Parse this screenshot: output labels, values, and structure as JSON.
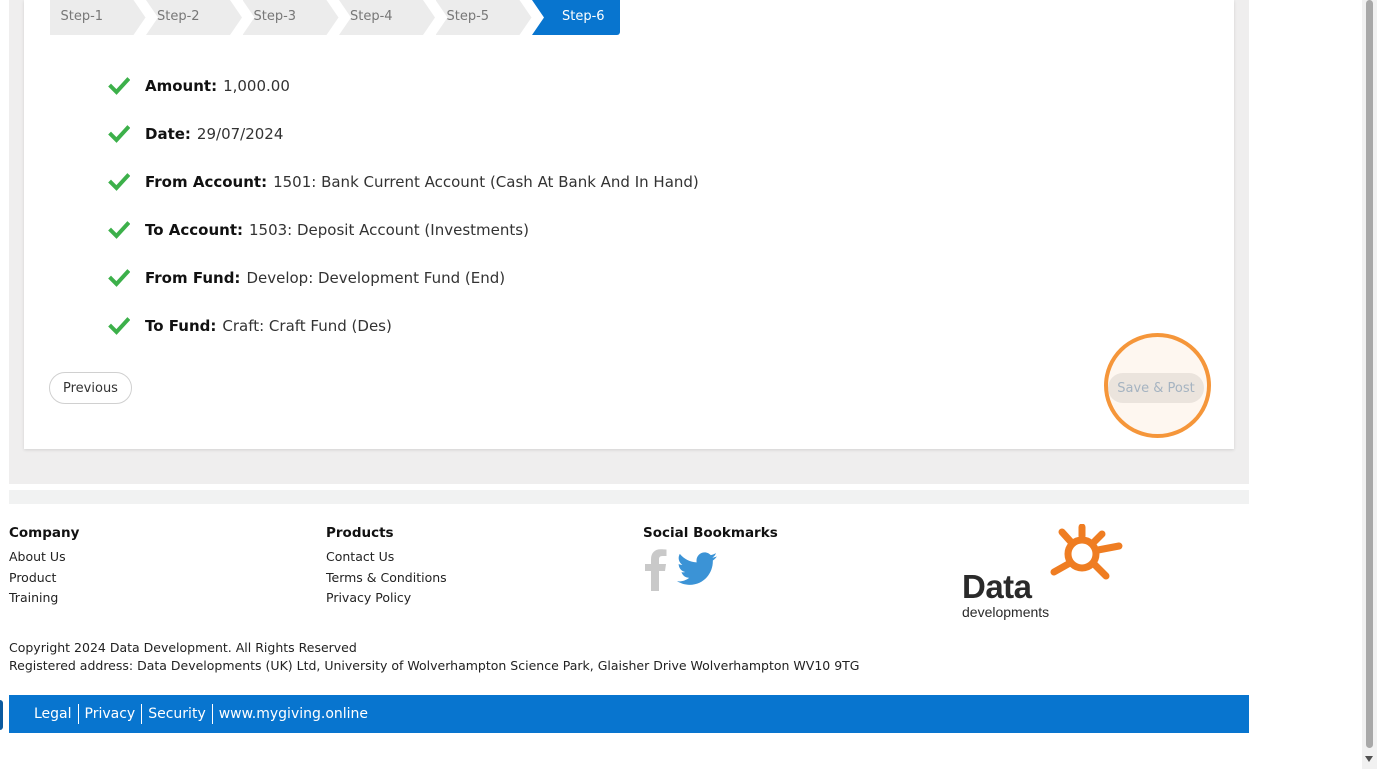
{
  "steps": [
    {
      "label": "Step-1",
      "active": false
    },
    {
      "label": "Step-2",
      "active": false
    },
    {
      "label": "Step-3",
      "active": false
    },
    {
      "label": "Step-4",
      "active": false
    },
    {
      "label": "Step-5",
      "active": false
    },
    {
      "label": "Step-6",
      "active": true
    }
  ],
  "summary": [
    {
      "label": "Amount:",
      "value": "1,000.00"
    },
    {
      "label": "Date:",
      "value": "29/07/2024"
    },
    {
      "label": "From Account:",
      "value": "1501: Bank Current Account (Cash At Bank And In Hand)"
    },
    {
      "label": "To Account:",
      "value": "1503: Deposit Account (Investments)"
    },
    {
      "label": "From Fund:",
      "value": "Develop: Development Fund (End)"
    },
    {
      "label": "To Fund:",
      "value": "Craft: Craft Fund (Des)"
    }
  ],
  "buttons": {
    "previous": "Previous",
    "save_post": "Save & Post"
  },
  "footer": {
    "company": {
      "heading": "Company",
      "links": [
        "About Us",
        "Product",
        "Training"
      ]
    },
    "products": {
      "heading": "Products",
      "links": [
        "Contact Us",
        "Terms & Conditions",
        "Privacy Policy"
      ]
    },
    "social": {
      "heading": "Social Bookmarks",
      "icons": [
        "facebook-icon",
        "twitter-icon"
      ]
    },
    "logo": {
      "word": "Data",
      "sub": "developments"
    },
    "copyright": "Copyright 2024 Data Development. All Rights Reserved",
    "address": "Registered address: Data Developments (UK) Ltd, University of Wolverhampton Science Park, Glaisher Drive Wolverhampton WV10 9TG"
  },
  "bottom_links": [
    "Legal",
    "Privacy",
    "Security",
    "www.mygiving.online"
  ],
  "colors": {
    "primary": "#0875cf",
    "check": "#3cb04a",
    "highlight": "#f5963a",
    "logo_orange": "#ef7d22"
  }
}
